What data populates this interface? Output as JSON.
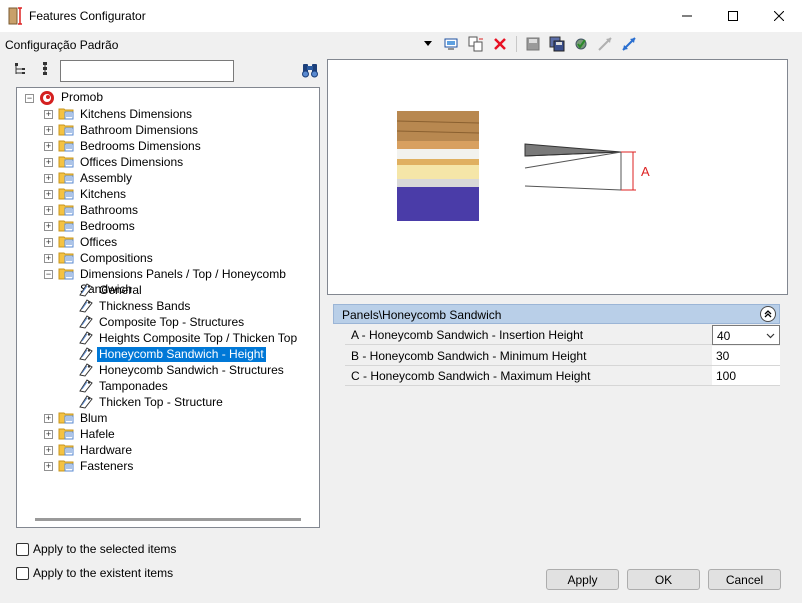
{
  "window": {
    "title": "Features Configurator"
  },
  "config": {
    "name": "Configuração Padrão"
  },
  "toolbar": {
    "icons": [
      "dropdown-arrow-icon",
      "monitor-icon",
      "copy-icon",
      "delete-icon",
      "save-icon",
      "save-as-icon",
      "settings-check-icon",
      "collapse-arrows-icon",
      "expand-arrows-icon"
    ]
  },
  "search": {
    "value": "",
    "placeholder": ""
  },
  "tree": {
    "root": "Promob",
    "items": [
      {
        "label": "Kitchens Dimensions"
      },
      {
        "label": "Bathroom Dimensions"
      },
      {
        "label": "Bedrooms Dimensions"
      },
      {
        "label": "Offices Dimensions"
      },
      {
        "label": "Assembly"
      },
      {
        "label": "Kitchens"
      },
      {
        "label": "Bathrooms"
      },
      {
        "label": "Bedrooms"
      },
      {
        "label": "Offices"
      },
      {
        "label": "Compositions"
      },
      {
        "label": "Dimensions Panels / Top / Honeycomb Sandwich"
      }
    ],
    "children": [
      {
        "label": "General"
      },
      {
        "label": "Thickness Bands"
      },
      {
        "label": "Composite Top - Structures"
      },
      {
        "label": "Heights Composite Top / Thicken Top"
      },
      {
        "label": "Honeycomb Sandwich - Height",
        "selected": true
      },
      {
        "label": "Honeycomb Sandwich - Structures"
      },
      {
        "label": "Tamponades"
      },
      {
        "label": "Thicken Top - Structure"
      }
    ],
    "after": [
      {
        "label": "Blum"
      },
      {
        "label": "Hafele"
      },
      {
        "label": "Hardware"
      },
      {
        "label": "Fasteners"
      }
    ]
  },
  "preview": {
    "dimension_label": "A"
  },
  "properties": {
    "header": "Panels\\Honeycomb Sandwich",
    "rows": [
      {
        "label": "A - Honeycomb Sandwich - Insertion Height",
        "value": "40"
      },
      {
        "label": "B - Honeycomb Sandwich - Minimum Height",
        "value": "30"
      },
      {
        "label": "C - Honeycomb Sandwich - Maximum Height",
        "value": "100"
      }
    ]
  },
  "options": {
    "apply_selected": "Apply to the selected items",
    "apply_existent": "Apply to the existent items"
  },
  "buttons": {
    "apply": "Apply",
    "ok": "OK",
    "cancel": "Cancel"
  },
  "colors": {
    "selection": "#0078d7",
    "header_bg": "#b9cfe8",
    "folder": "#f5c242",
    "delete": "#e81123"
  }
}
